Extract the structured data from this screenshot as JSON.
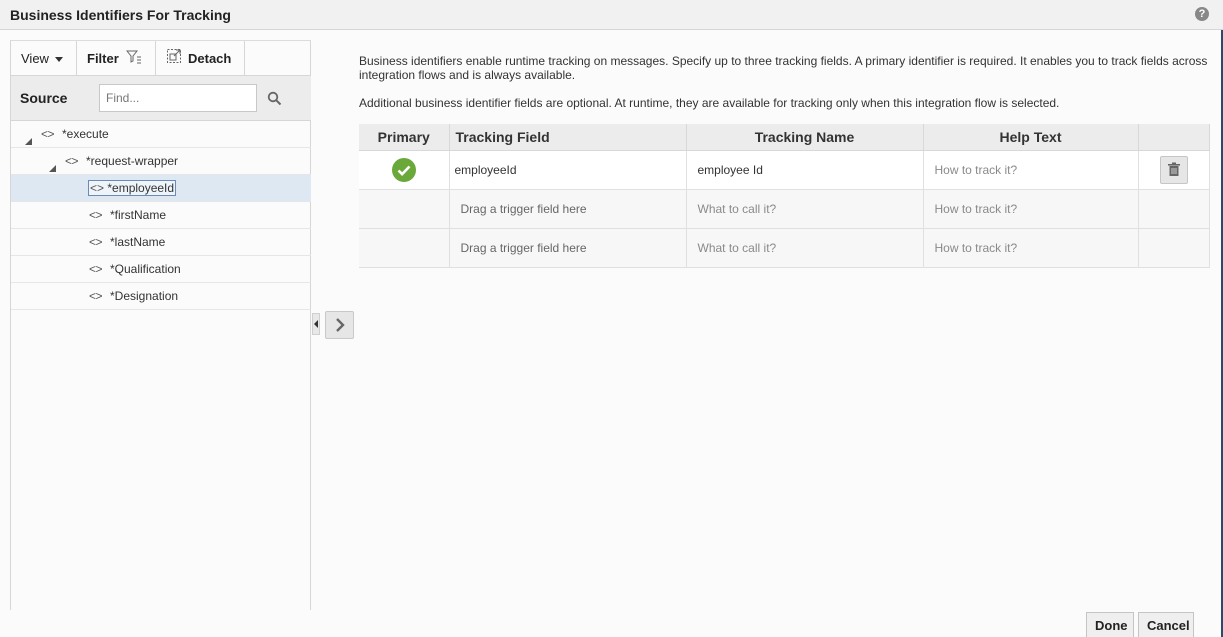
{
  "dialog": {
    "title": "Business Identifiers For Tracking",
    "help_icon": "?"
  },
  "toolbar": {
    "view_label": "View",
    "filter_label": "Filter",
    "detach_label": "Detach"
  },
  "source": {
    "label": "Source",
    "search_placeholder": "Find..."
  },
  "tree": {
    "items": [
      {
        "label": "*execute"
      },
      {
        "label": "*request-wrapper"
      },
      {
        "label": "*employeeId"
      },
      {
        "label": "*firstName"
      },
      {
        "label": "*lastName"
      },
      {
        "label": "*Qualification"
      },
      {
        "label": "*Designation"
      }
    ]
  },
  "description": {
    "line1": "Business identifiers enable runtime tracking on messages. Specify up to three tracking fields. A primary identifier is required. It enables you to track fields across integration flows and is always available.",
    "line2": "Additional business identifier fields are optional. At runtime, they are available for tracking only when this integration flow is selected."
  },
  "grid": {
    "headers": {
      "primary": "Primary",
      "tracking_field": "Tracking Field",
      "tracking_name": "Tracking Name",
      "help_text": "Help Text"
    },
    "rows": [
      {
        "primary": true,
        "tracking_field": "employeeId",
        "tracking_name": "employee Id",
        "help_text": "How to track it?"
      },
      {
        "primary": false,
        "tracking_field": "Drag a trigger field here",
        "tracking_name": "What to call it?",
        "help_text": "How to track it?"
      },
      {
        "primary": false,
        "tracking_field": "Drag a trigger field here",
        "tracking_name": "What to call it?",
        "help_text": "How to track it?"
      }
    ]
  },
  "footer": {
    "done_label": "Done",
    "cancel_label": "Cancel"
  },
  "colors": {
    "accent": "#6ba83a",
    "selection": "#dde8f3",
    "header_bg": "#ececec"
  }
}
